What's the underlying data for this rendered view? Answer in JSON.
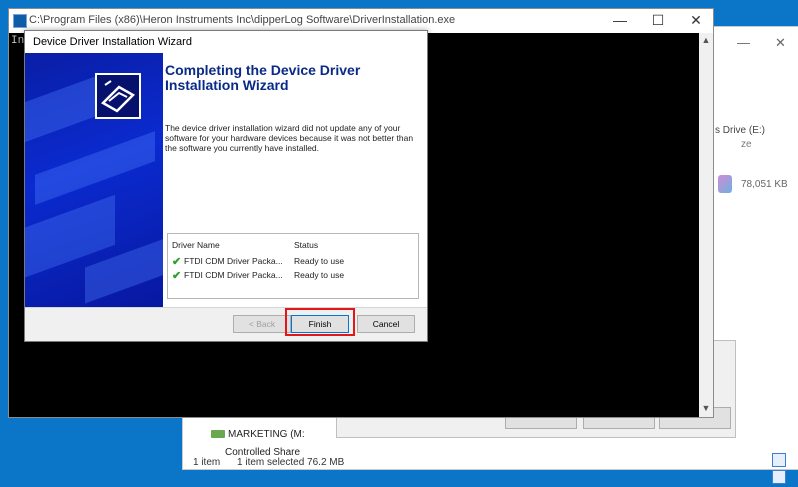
{
  "console": {
    "title": "C:\\Program Files (x86)\\Heron Instruments Inc\\dipperLog Software\\DriverInstallation.exe",
    "prompt_text": "Ins",
    "minimize": "—",
    "maximize": "☐",
    "close": "✕"
  },
  "wizard": {
    "title": "Device Driver Installation Wizard",
    "heading": "Completing the Device Driver Installation Wizard",
    "description": "The device driver installation wizard did not update any of your software for your hardware devices because it was not better than the software you currently have installed.",
    "table": {
      "headers": [
        "Driver Name",
        "Status"
      ],
      "rows": [
        {
          "name": "FTDI CDM Driver Packa...",
          "status": "Ready to use"
        },
        {
          "name": "FTDI CDM Driver Packa...",
          "status": "Ready to use"
        }
      ]
    },
    "buttons": {
      "back": "< Back",
      "finish": "Finish",
      "cancel": "Cancel"
    }
  },
  "explorer": {
    "drive_label": "s Drive (E:)",
    "column_fragment": "ze",
    "file_size": "78,051 KB",
    "network_item": "MARKETING (M:",
    "network_item2": "Controlled Share",
    "status": {
      "count": "1 item",
      "selected": "1 item selected  76.2 MB"
    },
    "minimize": "—",
    "close": "✕"
  },
  "colors": {
    "accent": "#0078d7",
    "highlight": "#e21818",
    "banner": "#0b2bd0",
    "heading": "#0a2a88",
    "check": "#2e9e2e"
  }
}
